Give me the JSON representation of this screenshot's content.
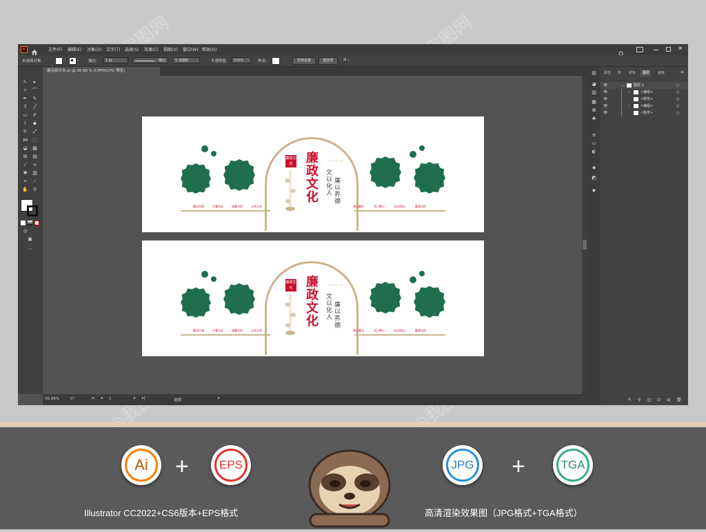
{
  "app": {
    "logo": "Ai",
    "menus": [
      "文件(F)",
      "编辑(E)",
      "对象(O)",
      "文字(T)",
      "选择(S)",
      "效果(C)",
      "视图(V)",
      "窗口(W)",
      "帮助(H)"
    ]
  },
  "control_bar": {
    "selection_label": "未选择对象",
    "stroke_label": "描边:",
    "stroke_value": "1 pt",
    "stroke_style": "等比",
    "brush_label": "5 点圆形",
    "opacity_label": "不透明度:",
    "opacity_value": "100%",
    "style_label": "样式:",
    "doc_setup_button": "文档设置",
    "prefs_button": "首选项"
  },
  "document_tab": {
    "title": "廉洁政文化.ai @ 36.99 % (CMYK/CPU 预览)"
  },
  "status_bar": {
    "zoom": "36.99%",
    "rotation": "0°",
    "artboard_number": "1",
    "tool_name": "选择"
  },
  "layers_panel": {
    "tabs": [
      "属性",
      "库",
      "颜色",
      "图层",
      "画板"
    ],
    "active_tab": "图层",
    "rows": [
      {
        "name": "图层 1",
        "expanded": true
      },
      {
        "name": "<编组>",
        "expanded": false
      },
      {
        "name": "<矩形>",
        "expanded": false
      },
      {
        "name": "<编组>",
        "expanded": false
      },
      {
        "name": "<矩形>",
        "expanded": false
      }
    ]
  },
  "artwork": {
    "seal_text": "廉政文化",
    "main_title": "廉政文化",
    "sub_line_1": "廉以养德",
    "sub_line_2": "文以化人",
    "slogans_left": [
      "廉洁为政",
      "行事为官",
      "清廉为民",
      "心系为本"
    ],
    "slogans_right": [
      "清正廉洁",
      "克己奉公",
      "执法如山",
      "勤政为民"
    ],
    "accent_green": "#1f6e4e",
    "accent_red": "#c8102e",
    "accent_gold": "#c8b48e"
  },
  "promo": {
    "badge_ai": "Ai",
    "badge_eps": "EPS",
    "badge_jpg": "JPG",
    "badge_tga": "TGA",
    "plus": "+",
    "caption_left": "Illustrator CC2022+CS6版本+EPS格式",
    "caption_right": "高清渲染效果图（JPG格式+TGA格式）",
    "mascot": "sloth-mascot-icon"
  }
}
